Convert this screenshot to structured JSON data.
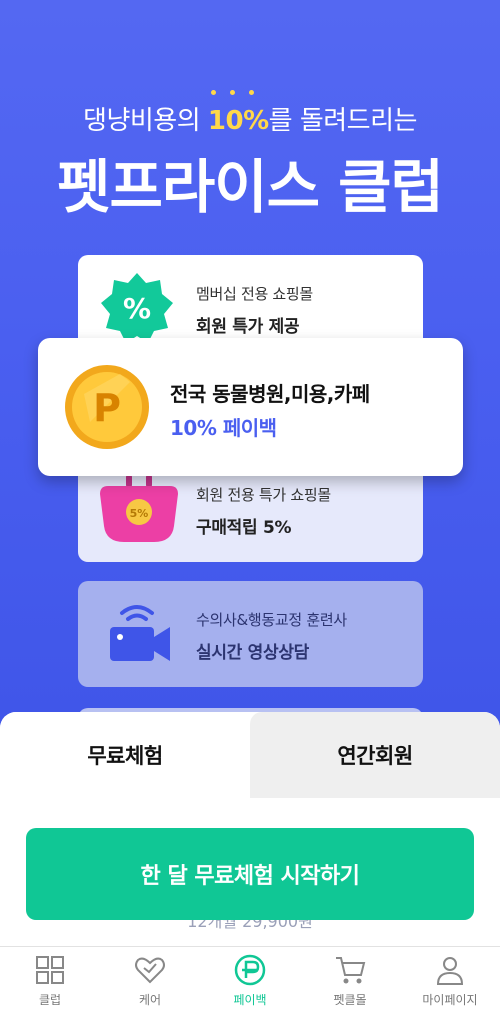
{
  "hero": {
    "subtitle_before": "댕냥비용의 ",
    "subtitle_highlight": "10%",
    "subtitle_after": "를 돌려드리는",
    "title": "펫프라이스 클럽"
  },
  "cards": {
    "shop": {
      "small": "멤버십 전용 쇼핑몰",
      "big": "회원 특가 제공",
      "badge": "%"
    },
    "mall": {
      "small": "회원 전용 특가 쇼핑몰",
      "big": "구매적립 5%",
      "badge": "5%"
    },
    "vet": {
      "small": "수의사&행동교정 훈련사",
      "big": "실시간 영상상담"
    }
  },
  "popup": {
    "line1": "전국 동물병원,미용,카페",
    "line2": "10% 페이백",
    "coin_letter": "P"
  },
  "sheet": {
    "tab_free": "무료체험",
    "tab_annual": "연간회원",
    "cta": "한 달 무료체험 시작하기",
    "behind_text": "12개월 29,900원"
  },
  "nav": {
    "club": "클럽",
    "care": "케어",
    "payback": "페이백",
    "mall": "펫클몰",
    "mypage": "마이페이지"
  },
  "colors": {
    "primary": "#4a5ff0",
    "accent": "#10c795",
    "highlight": "#ffd84a"
  }
}
